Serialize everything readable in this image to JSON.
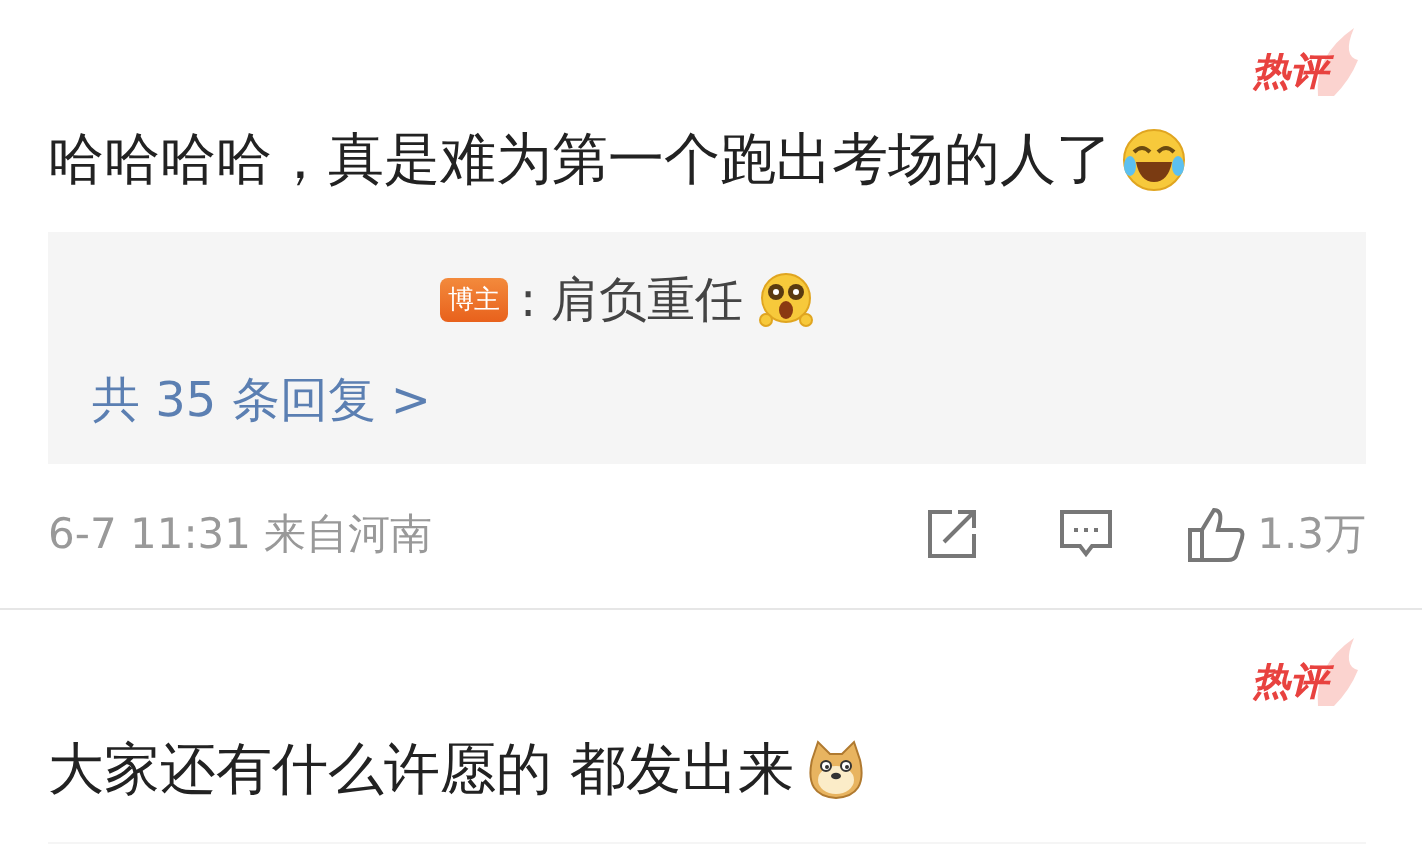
{
  "comments": [
    {
      "hot_label": "热评",
      "text": "哈哈哈哈，真是难为第一个跑出考场的人了",
      "reply_box": {
        "author_badge": "博主",
        "reply_text": ": 肩负重任",
        "more_replies": "共 35 条回复 >"
      },
      "time": "6-7 11:31",
      "location": "来自河南",
      "likes": "1.3万"
    },
    {
      "hot_label": "热评",
      "text": "大家还有什么许愿的 都发出来",
      "continues_below": true
    }
  ]
}
